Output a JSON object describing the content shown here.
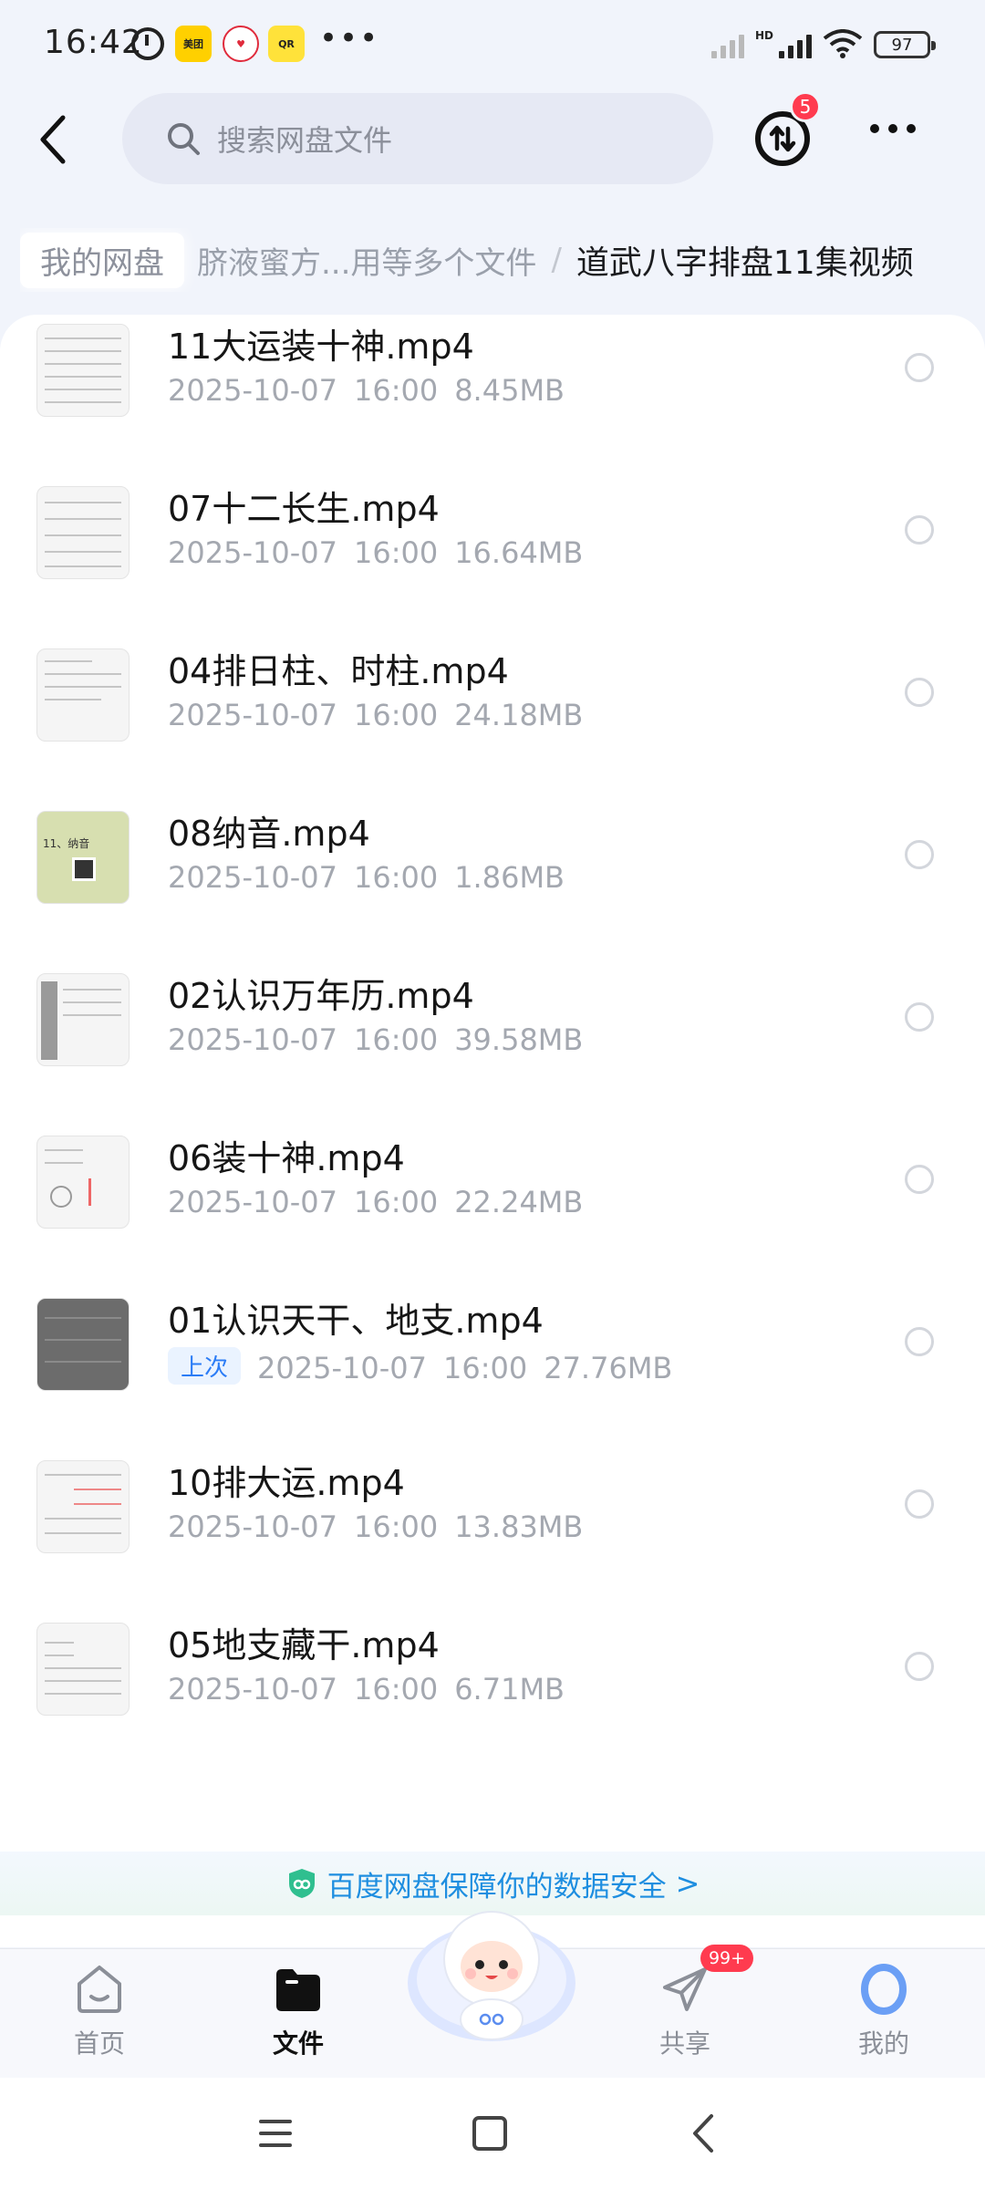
{
  "status_bar": {
    "time": "16:42",
    "apps": [
      "美团",
      "♥",
      "QR"
    ],
    "more": "•••",
    "network": "HD",
    "battery": "97"
  },
  "header": {
    "search_placeholder": "搜索网盘文件",
    "transfer_badge": "5"
  },
  "breadcrumb": {
    "root": "我的网盘",
    "middle": "脐液蜜方...用等多个文件",
    "separator": "/",
    "current": "道武八字排盘11集视频"
  },
  "files": [
    {
      "name": "11大运装十神.mp4",
      "date": "2025-10-07",
      "time": "16:00",
      "size": "8.45MB"
    },
    {
      "name": "07十二长生.mp4",
      "date": "2025-10-07",
      "time": "16:00",
      "size": "16.64MB"
    },
    {
      "name": "04排日柱、时柱.mp4",
      "date": "2025-10-07",
      "time": "16:00",
      "size": "24.18MB"
    },
    {
      "name": "08纳音.mp4",
      "date": "2025-10-07",
      "time": "16:00",
      "size": "1.86MB",
      "thumb_text": "11、纳音"
    },
    {
      "name": "02认识万年历.mp4",
      "date": "2025-10-07",
      "time": "16:00",
      "size": "39.58MB"
    },
    {
      "name": "06装十神.mp4",
      "date": "2025-10-07",
      "time": "16:00",
      "size": "22.24MB"
    },
    {
      "name": "01认识天干、地支.mp4",
      "tag": "上次",
      "date": "2025-10-07",
      "time": "16:00",
      "size": "27.76MB"
    },
    {
      "name": "10排大运.mp4",
      "date": "2025-10-07",
      "time": "16:00",
      "size": "13.83MB"
    },
    {
      "name": "05地支藏干.mp4",
      "date": "2025-10-07",
      "time": "16:00",
      "size": "6.71MB"
    }
  ],
  "security_banner": {
    "text": "百度网盘保障你的数据安全",
    "arrow": ">"
  },
  "nav": {
    "home": "首页",
    "files": "文件",
    "share": "共享",
    "share_badge": "99+",
    "mine": "我的"
  },
  "colors": {
    "accent": "#1e8ee0",
    "badge": "#ff3b4f",
    "background": "#f1f4fb"
  }
}
